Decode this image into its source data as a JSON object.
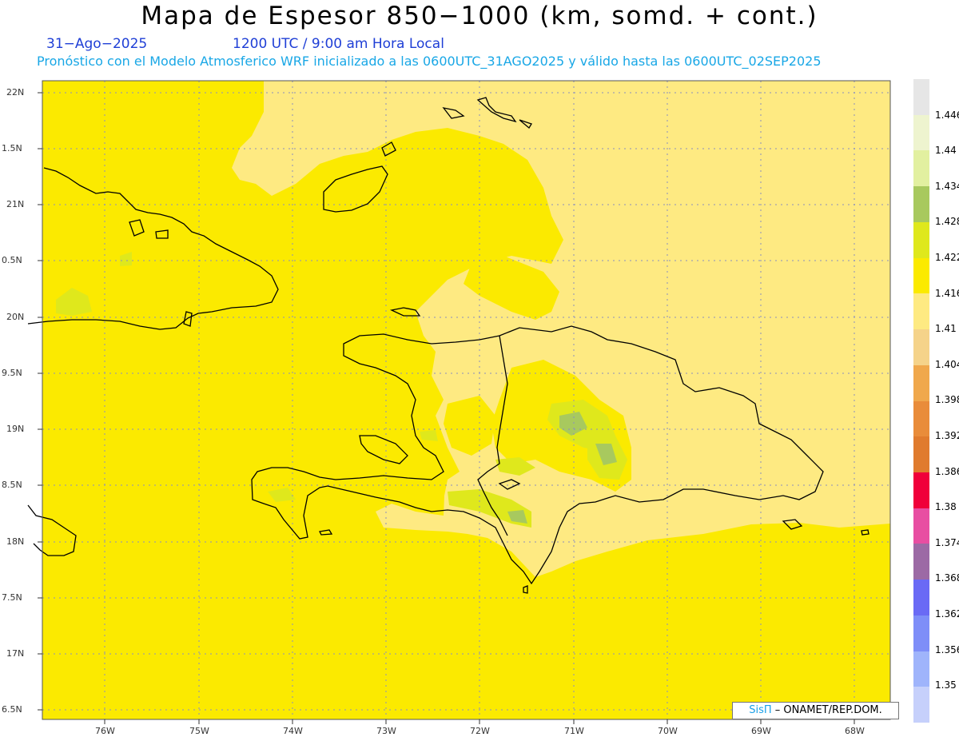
{
  "header": {
    "title": "Mapa de Espesor 850−1000 (km, somd. + cont.)",
    "date": "31−Ago−2025",
    "time": "1200 UTC / 9:00 am Hora Local",
    "subtitle": "Pronóstico con el Modelo Atmosferico WRF inicializado a las 0600UTC_31AGO2025 y válido hasta las  0600UTC_02SEP2025"
  },
  "axes": {
    "lat_labels": [
      "22N",
      "1.5N",
      "21N",
      "0.5N",
      "20N",
      "9.5N",
      "19N",
      "8.5N",
      "18N",
      "7.5N",
      "17N",
      "6.5N"
    ],
    "lon_labels": [
      "76W",
      "75W",
      "74W",
      "73W",
      "72W",
      "71W",
      "70W",
      "69W",
      "68W"
    ]
  },
  "colorbar": {
    "labels": [
      "1.446",
      "1.44",
      "1.434",
      "1.428",
      "1.422",
      "1.416",
      "1.41",
      "1.404",
      "1.398",
      "1.392",
      "1.386",
      "1.38",
      "1.374",
      "1.368",
      "1.362",
      "1.356",
      "1.35"
    ],
    "colors": [
      "#e6e6e6",
      "#eef4cf",
      "#e2f0a0",
      "#a8c95e",
      "#dfe81c",
      "#fbea00",
      "#feea82",
      "#f5d38a",
      "#f0a84c",
      "#e98c3a",
      "#e07b2e",
      "#f0003a",
      "#e84ea2",
      "#9c6aa5",
      "#6a6af5",
      "#7e8ef8",
      "#9fb4fb",
      "#c6d0fb"
    ]
  },
  "credit": {
    "brand": "SisΠ",
    "org": "– ONAMET/REP.DOM."
  },
  "colors": {
    "base_field": "#fbea00",
    "lower_field": "#feea82",
    "green_field": "#dfe81c",
    "dark_green": "#a8c95e",
    "gridline": "#8a8fbf",
    "coast": "#000000"
  }
}
